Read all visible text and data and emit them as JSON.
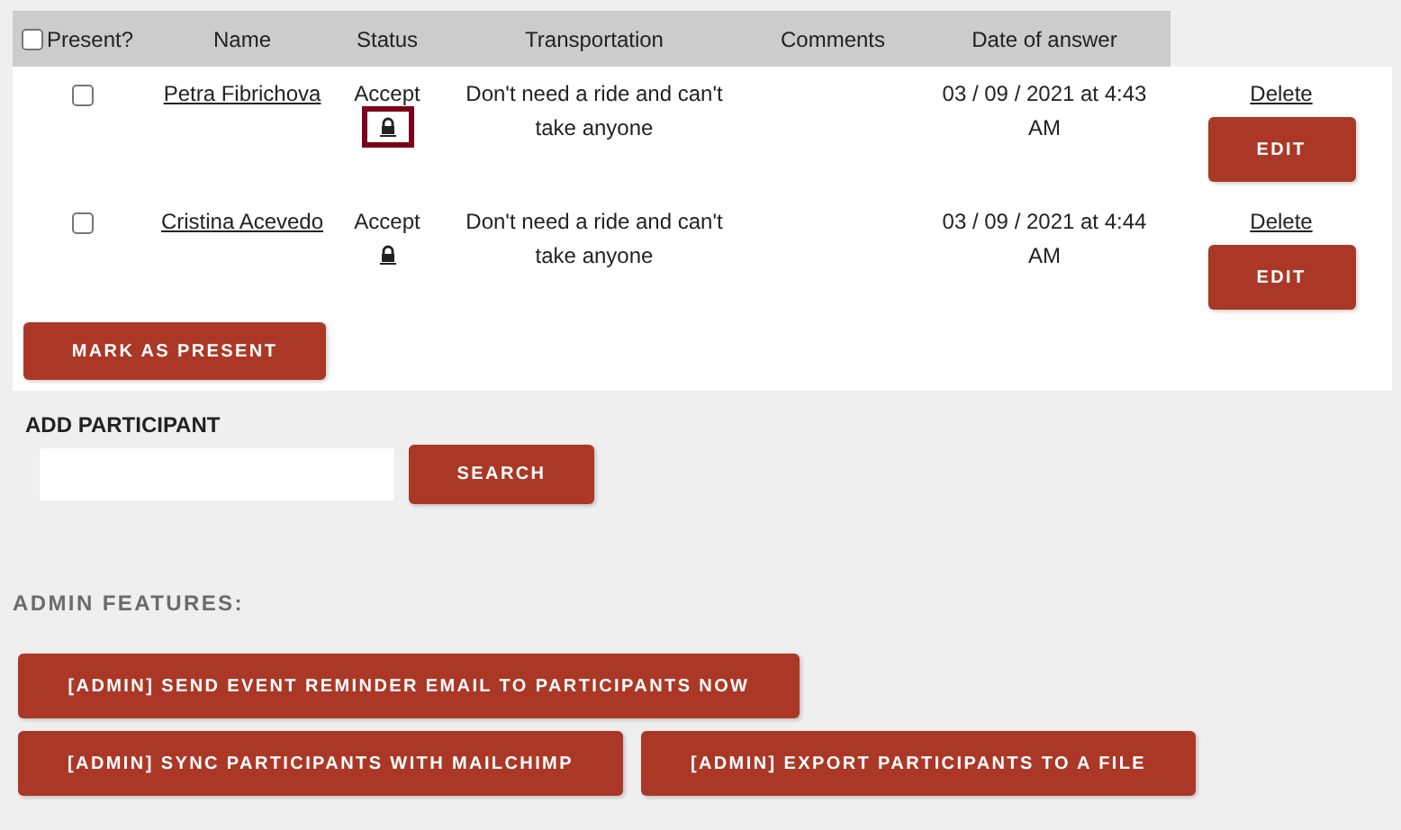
{
  "table": {
    "select_all": {
      "label": "Present?",
      "checked": false
    },
    "columns": [
      "Name",
      "Status",
      "Transportation",
      "Comments",
      "Date of answer"
    ],
    "rows": [
      {
        "checked": false,
        "name": "Petra Fibrichova",
        "status": "Accept",
        "lock_focused": true,
        "transportation": "Don't need a ride and can't take anyone",
        "date": "03 / 09 / 2021 at 4:43 AM",
        "delete": "Delete",
        "edit": "EDIT"
      },
      {
        "checked": false,
        "name": "Cristina Acevedo",
        "status": "Accept",
        "lock_focused": false,
        "transportation": "Don't need a ride and can't take anyone",
        "date": "03 / 09 / 2021 at 4:44 AM",
        "delete": "Delete",
        "edit": "EDIT"
      }
    ],
    "mark_button": "MARK AS PRESENT"
  },
  "add_participant": {
    "label": "ADD PARTICIPANT",
    "search_button": "SEARCH"
  },
  "admin": {
    "heading": "ADMIN FEATURES:",
    "buttons": [
      "[ADMIN] SEND EVENT REMINDER EMAIL TO PARTICIPANTS NOW",
      "[ADMIN] SYNC PARTICIPANTS WITH MAILCHIMP",
      "[ADMIN] EXPORT PARTICIPANTS TO A FILE"
    ]
  }
}
